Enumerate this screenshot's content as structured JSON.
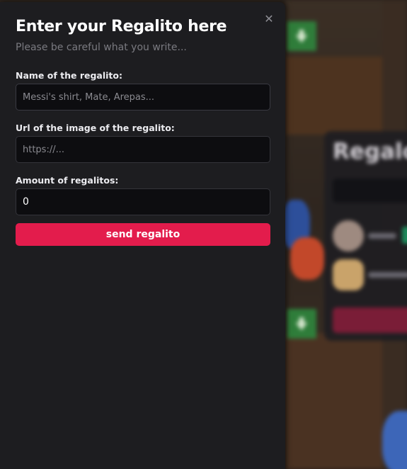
{
  "modal": {
    "title": "Enter your Regalito here",
    "subtitle": "Please be careful what you write...",
    "close_icon": "close-icon",
    "fields": {
      "name": {
        "label": "Name of the regalito:",
        "placeholder": "Messi's shirt, Mate, Arepas...",
        "value": ""
      },
      "image_url": {
        "label": "Url of the image of the regalito:",
        "placeholder": "https://...",
        "value": ""
      },
      "amount": {
        "label": "Amount of regalitos:",
        "placeholder": "",
        "value": "0"
      }
    },
    "submit_label": "send regalito"
  },
  "background_card": {
    "title": "Regalo"
  },
  "colors": {
    "accent": "#e31c4c",
    "modal_bg": "#1d1d20",
    "input_bg": "#0d0d10"
  }
}
